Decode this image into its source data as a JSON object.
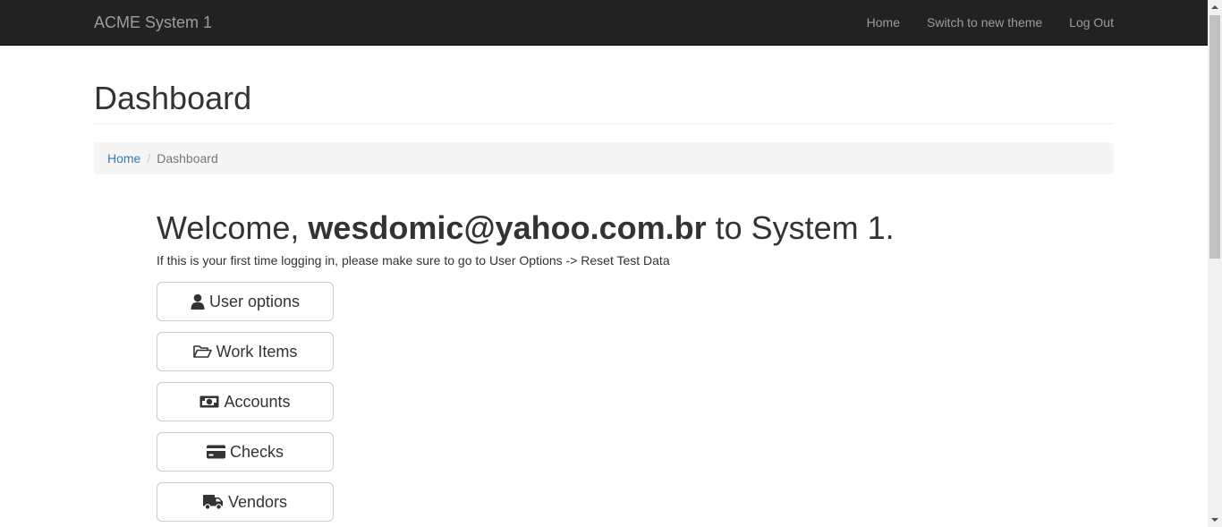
{
  "navbar": {
    "brand": "ACME System 1",
    "links": [
      "Home",
      "Switch to new theme",
      "Log Out"
    ],
    "background": "#222222",
    "text_color": "#9d9d9d"
  },
  "page": {
    "title": "Dashboard"
  },
  "breadcrumb": {
    "home": "Home",
    "separator": "/",
    "current": "Dashboard"
  },
  "welcome": {
    "prefix": "Welcome, ",
    "user": "wesdomic@yahoo.com.br",
    "suffix": " to System 1.",
    "hint": "If this is your first time logging in, please make sure to go to User Options -> Reset Test Data"
  },
  "buttons": [
    {
      "label": "User options",
      "icon": "user-icon"
    },
    {
      "label": "Work Items",
      "icon": "folder-open-icon"
    },
    {
      "label": "Accounts",
      "icon": "money-icon"
    },
    {
      "label": "Checks",
      "icon": "credit-card-icon"
    },
    {
      "label": "Vendors",
      "icon": "truck-icon"
    }
  ],
  "colors": {
    "link": "#337ab7",
    "breadcrumb_bg": "#f5f5f5",
    "button_border": "#cccccc"
  }
}
